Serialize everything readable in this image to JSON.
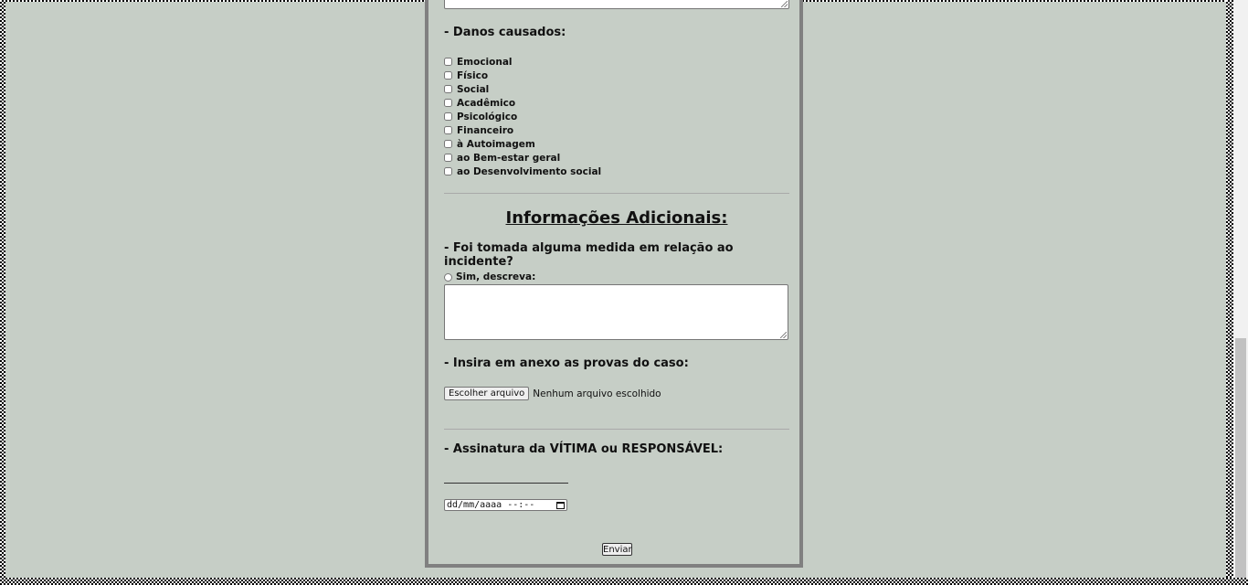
{
  "damages": {
    "heading": "- Danos causados:",
    "options": [
      "Emocional",
      "Físico",
      "Social",
      "Acadêmico",
      "Psicológico",
      "Financeiro",
      "à Autoimagem",
      "ao Bem-estar geral",
      "ao Desenvolvimento social"
    ]
  },
  "additional": {
    "title": "Informações Adicionais:",
    "measure_question": "- Foi tomada alguma medida em relação ao incidente?",
    "radio_label": "Sim, descreva:"
  },
  "attachments": {
    "heading": "- Insira em anexo as provas do caso:",
    "button_label": "Escolher arquivo",
    "status": "Nenhum arquivo escolhido"
  },
  "signature": {
    "heading": "- Assinatura da VÍTIMA ou RESPONSÁVEL:",
    "datetime_placeholder": "dd/mm/aaaa --:--"
  },
  "submit_label": "Enviar",
  "colors": {
    "background": "#c6cec6",
    "form_border": "#808080"
  }
}
